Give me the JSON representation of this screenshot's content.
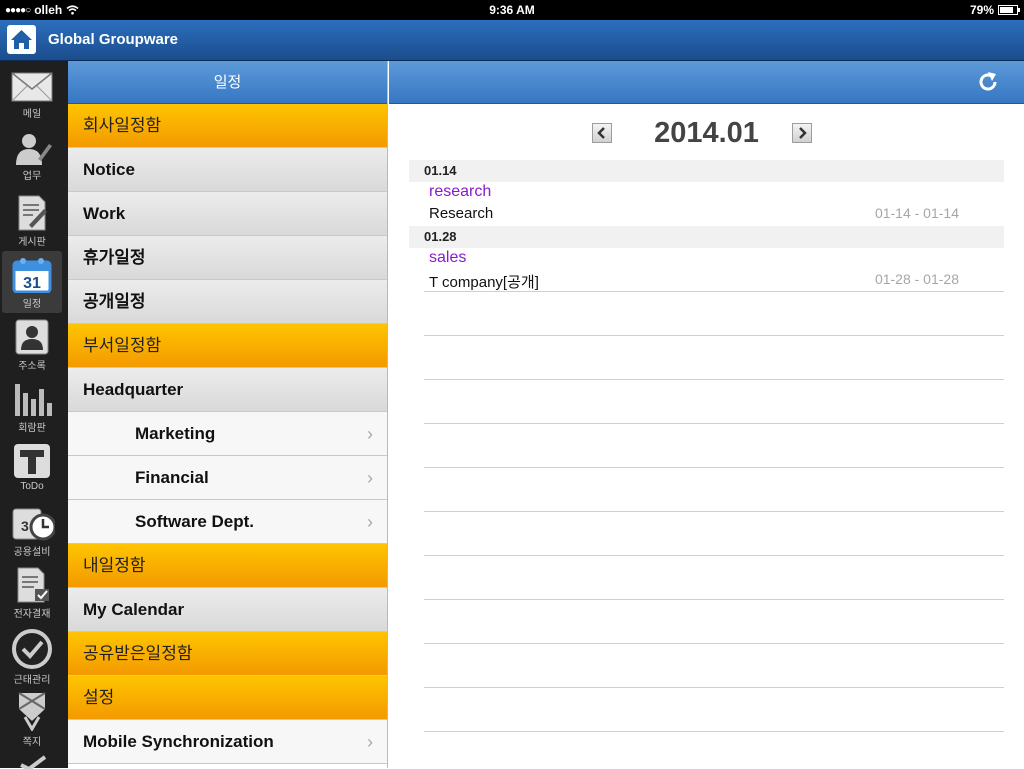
{
  "status_bar": {
    "carrier": "olleh",
    "time": "9:36 AM",
    "battery": "79%",
    "battery_level": 0.79
  },
  "app": {
    "title": "Global Groupware"
  },
  "rail": {
    "items": [
      {
        "label": "메일",
        "icon": "mail-icon"
      },
      {
        "label": "업무",
        "icon": "task-icon"
      },
      {
        "label": "게시판",
        "icon": "board-icon"
      },
      {
        "label": "일정",
        "icon": "calendar-icon",
        "calendar_day": "31",
        "active": true
      },
      {
        "label": "주소록",
        "icon": "contacts-icon"
      },
      {
        "label": "회람판",
        "icon": "bar-chart-icon"
      },
      {
        "label": "ToDo",
        "icon": "todo-icon"
      },
      {
        "label": "공용설비",
        "icon": "facility-clock-icon"
      },
      {
        "label": "전자결재",
        "icon": "approval-icon"
      },
      {
        "label": "근태관리",
        "icon": "attendance-check-icon"
      },
      {
        "label": "쪽지",
        "icon": "memo-icon"
      }
    ]
  },
  "left_panel": {
    "title": "일정",
    "rows": [
      {
        "label": "회사일정함",
        "style": "orange"
      },
      {
        "label": "Notice",
        "style": "gray"
      },
      {
        "label": "Work",
        "style": "gray"
      },
      {
        "label": "휴가일정",
        "style": "gray"
      },
      {
        "label": "공개일정",
        "style": "gray"
      },
      {
        "label": "부서일정함",
        "style": "orange"
      },
      {
        "label": "Headquarter",
        "style": "gray"
      },
      {
        "label": "Marketing",
        "style": "white",
        "indent": true,
        "chevron": true
      },
      {
        "label": "Financial",
        "style": "white",
        "indent": true,
        "chevron": true
      },
      {
        "label": "Software Dept.",
        "style": "white",
        "indent": true,
        "chevron": true
      },
      {
        "label": "내일정함",
        "style": "orange"
      },
      {
        "label": "My Calendar",
        "style": "gray"
      },
      {
        "label": "공유받은일정함",
        "style": "orange"
      },
      {
        "label": "설정",
        "style": "orange"
      },
      {
        "label": "Mobile Synchronization",
        "style": "white",
        "chevron": true
      }
    ]
  },
  "main": {
    "month": "2014.01",
    "events": [
      {
        "date": "01.14",
        "category": "research",
        "title": "Research",
        "range": "01-14 - 01-14"
      },
      {
        "date": "01.28",
        "category": "sales",
        "title": "T company[공개]",
        "range": "01-28 - 01-28"
      }
    ]
  },
  "colors": {
    "accent_blue": "#2c6fbd",
    "category_orange": "#f9b000",
    "event_category_purple": "#8a1ad0"
  }
}
